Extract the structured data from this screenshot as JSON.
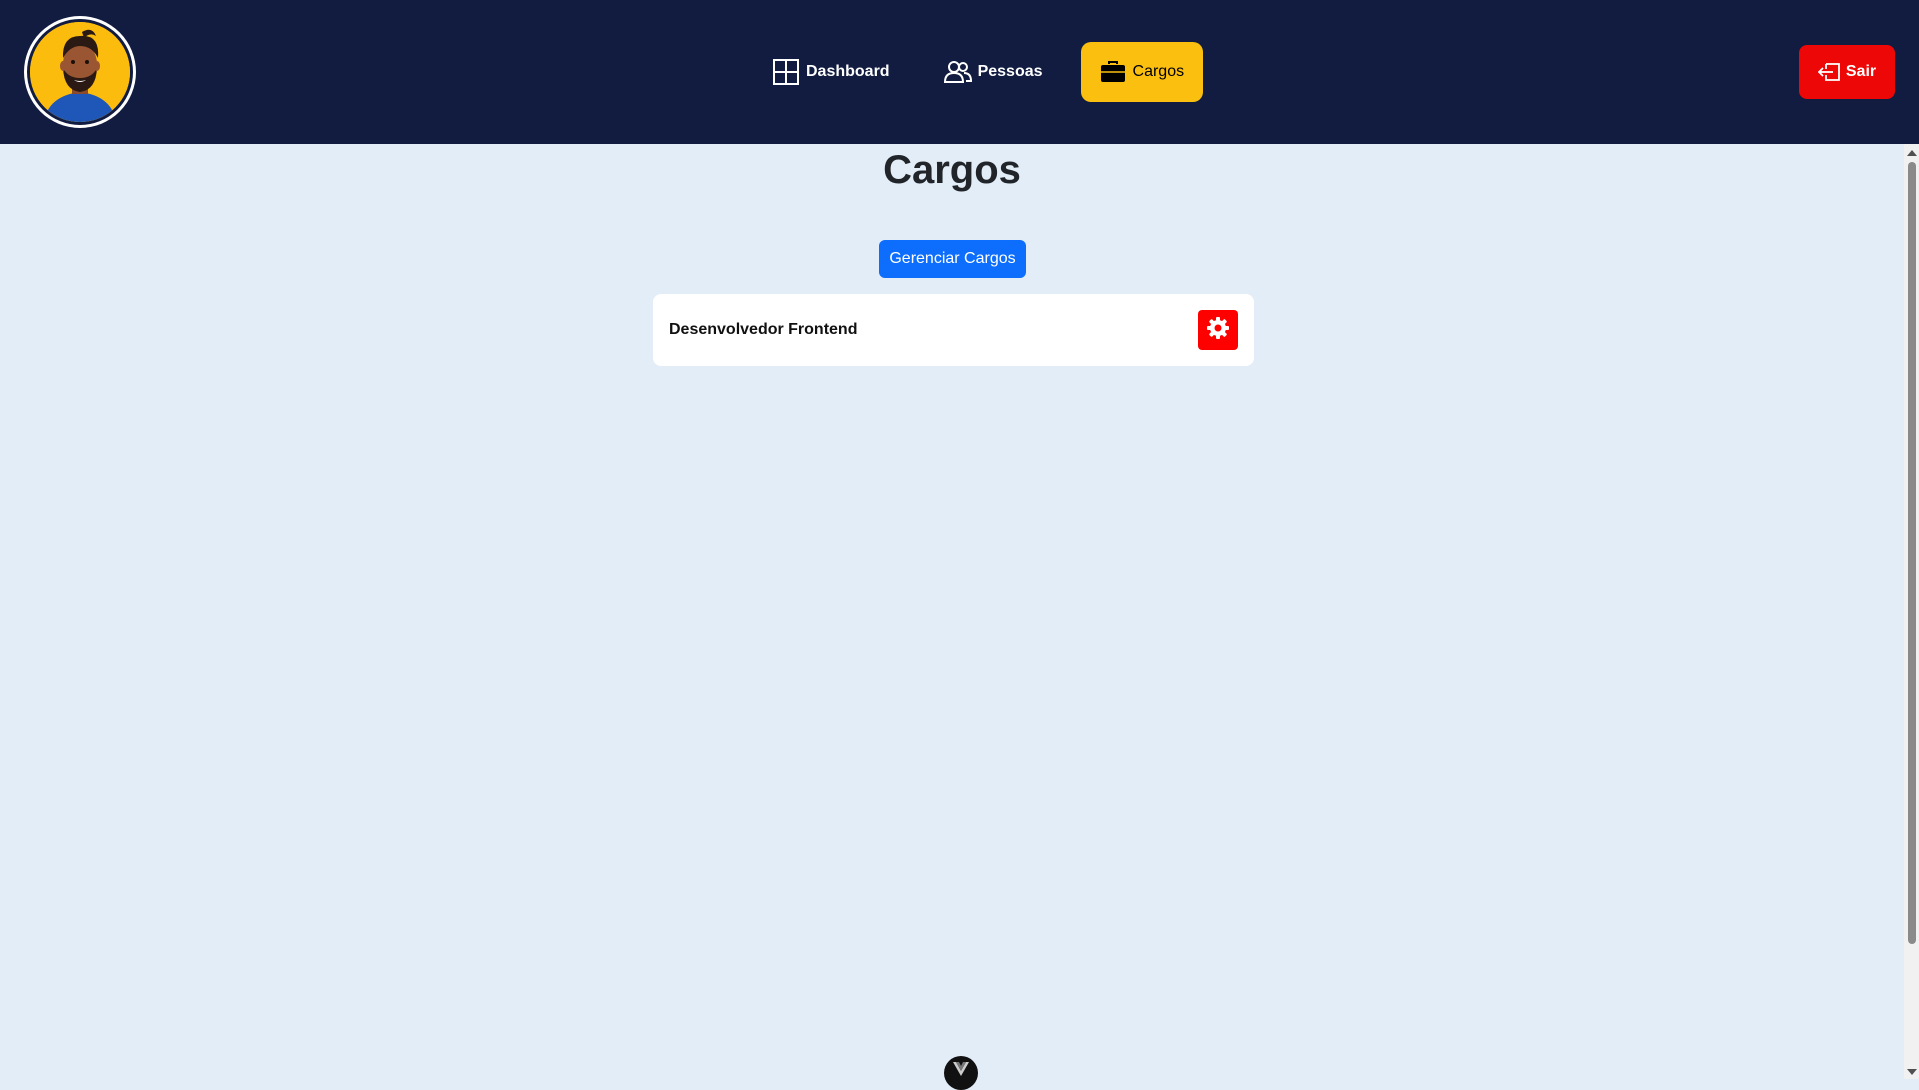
{
  "nav": {
    "items": [
      {
        "label": "Dashboard",
        "icon": "grid-icon"
      },
      {
        "label": "Pessoas",
        "icon": "people-icon"
      },
      {
        "label": "Cargos",
        "icon": "briefcase-icon"
      }
    ],
    "active": "Cargos",
    "logout_label": "Sair"
  },
  "page": {
    "title": "Cargos",
    "manage_button": "Gerenciar Cargos"
  },
  "cards": [
    {
      "title": "Desenvolvedor Frontend",
      "action_icon": "gear-icon"
    }
  ],
  "colors": {
    "topbar": "#111c40",
    "active_nav": "#fbbf10",
    "danger": "#ee0707",
    "primary": "#0d6efd",
    "background": "#e2edf8"
  }
}
